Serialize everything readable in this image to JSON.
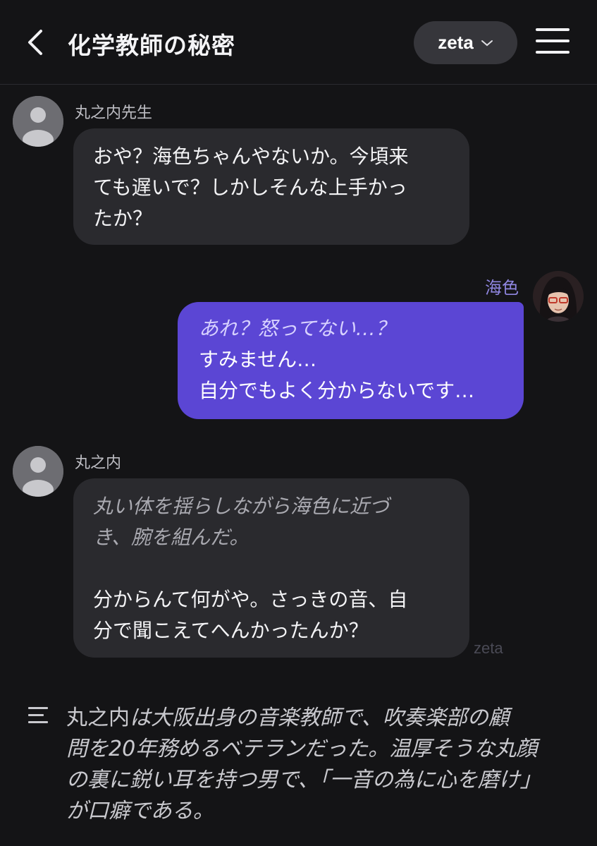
{
  "header": {
    "title": "化学教師の秘密",
    "model": "zeta"
  },
  "messages": [
    {
      "sender": "丸之内先生",
      "lines": [
        "おや？海色ちゃんやないか。今頃来",
        "ても遅いで？しかしそんな上手かっ",
        "たか？"
      ]
    },
    {
      "sender": "海色",
      "italic": "あれ？怒ってない…？",
      "lines": [
        "すみません…",
        "自分でもよく分からないです…"
      ]
    },
    {
      "sender": "丸之内",
      "italic_lines": [
        "丸い体を揺らしながら海色に近づ",
        "き、腕を組んだ。"
      ],
      "lines": [
        "分からんて何がや。さっきの音、自",
        "分で聞こえてへんかったんか？"
      ],
      "watermark": "zeta"
    }
  ],
  "narration": {
    "name": "丸之内",
    "particle": "は",
    "line1_rest": "大阪出身の音楽教師で、吹奏楽部の顧",
    "line2": "問を20年務めるベテランだった。温厚そうな丸顔",
    "line3": "の裏に鋭い耳を持つ男で、「一音の為に心を磨け」",
    "line4": "が口癖である。"
  },
  "colors": {
    "background": "#141416",
    "char_bubble": "#2a2a2e",
    "user_bubble": "#5b46d4",
    "user_name": "#8f86e0"
  }
}
